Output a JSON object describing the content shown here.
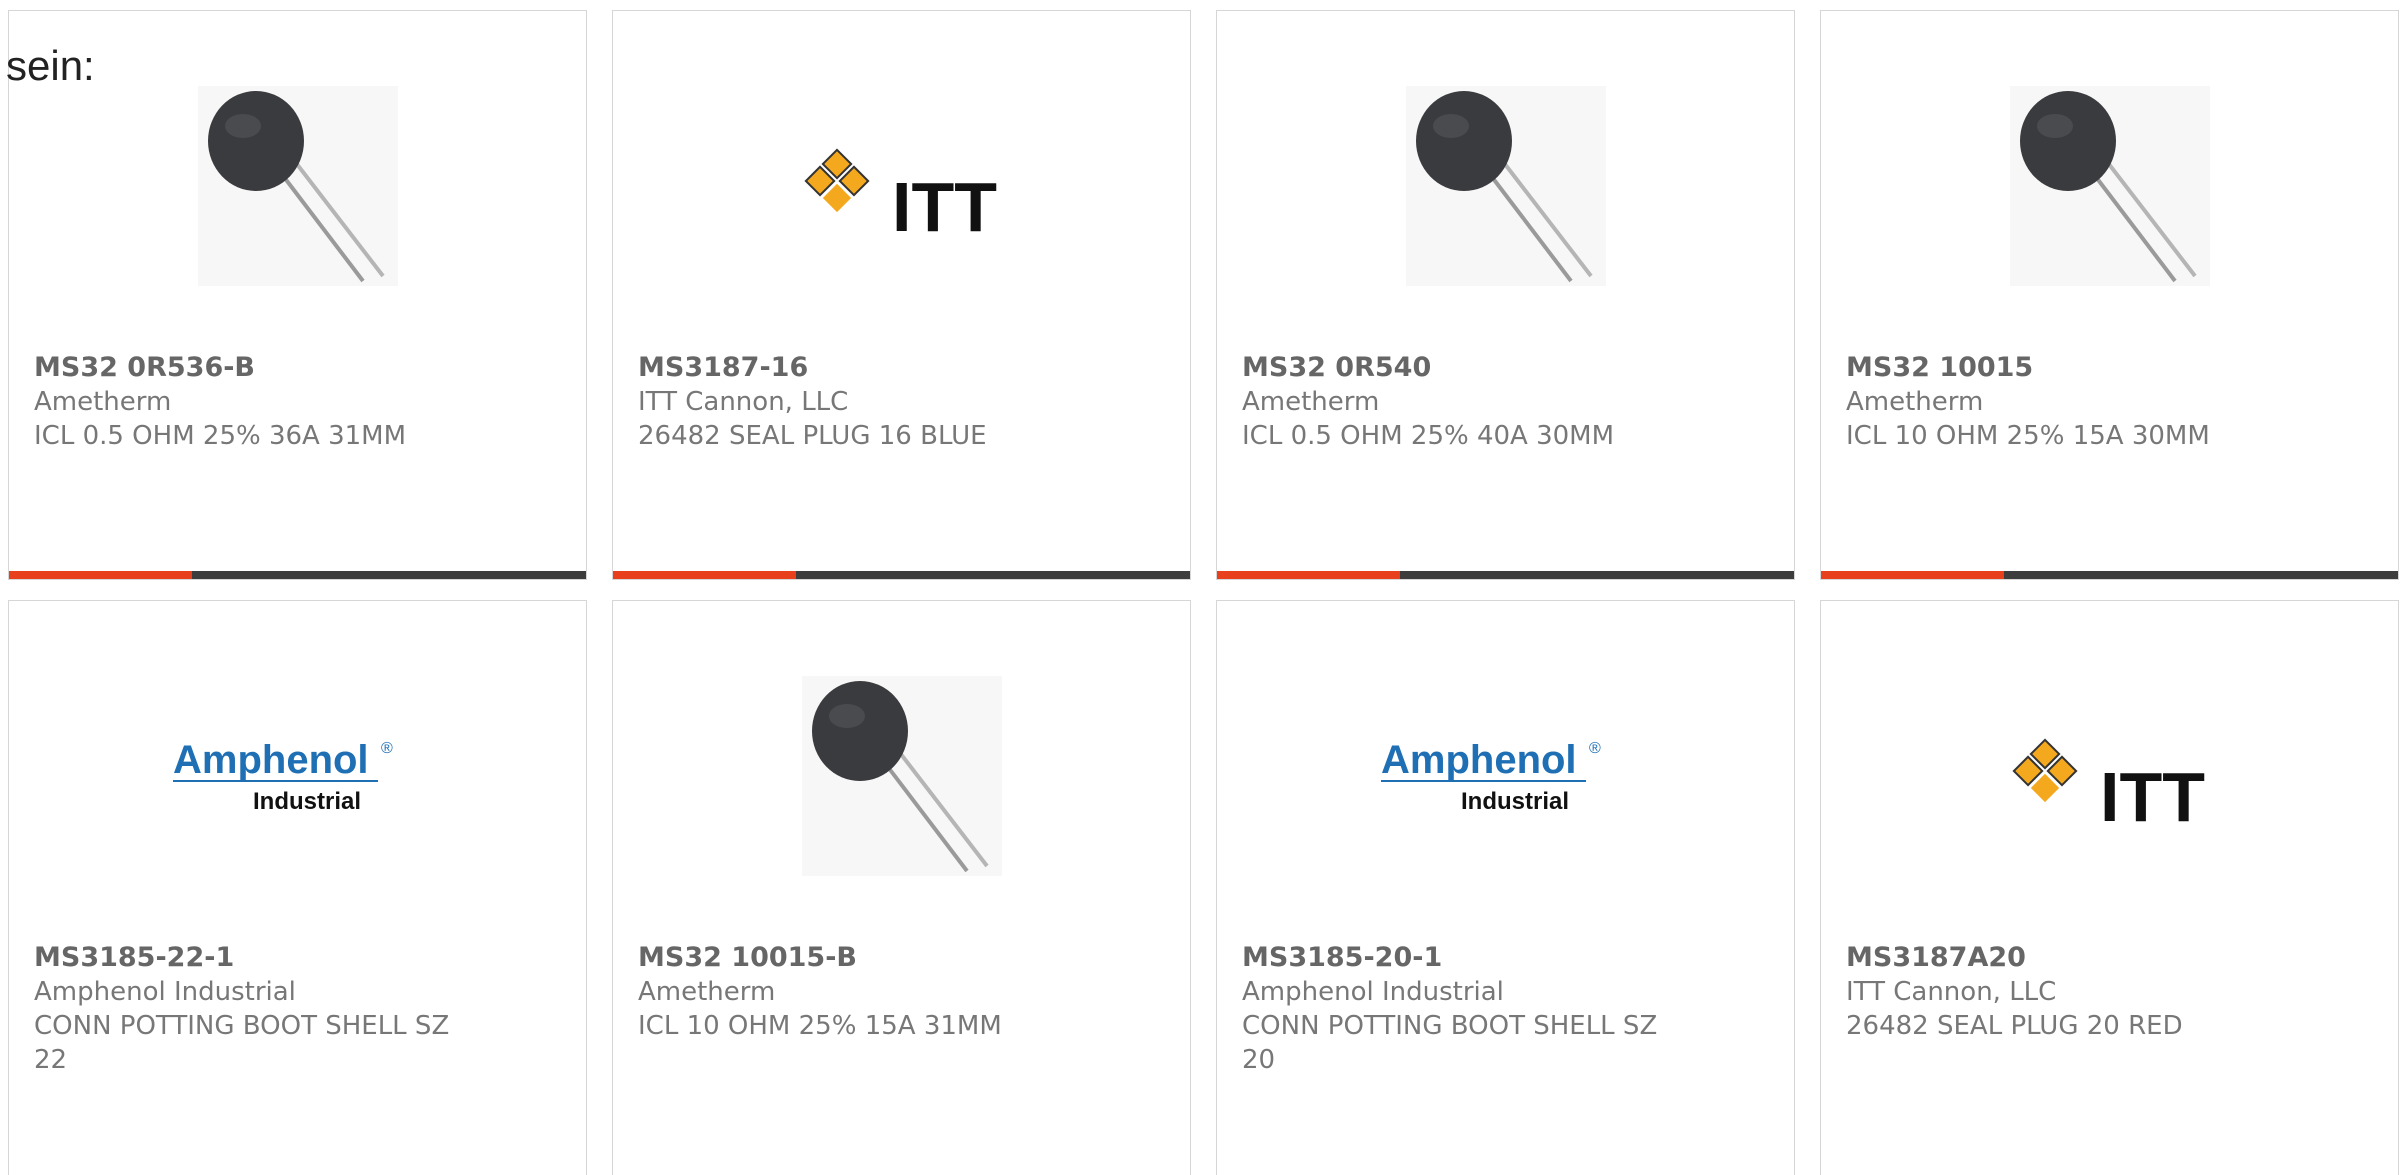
{
  "page": {
    "intro": "sein:"
  },
  "colors": {
    "accent": "#e8401c",
    "bar": "#3d3d3d",
    "border": "#d6d6d6",
    "text": "#777777",
    "amphenol_blue": "#1f6fb5",
    "itt_orange": "#f4a81d"
  },
  "products": [
    {
      "part_number": "MS32 0R536-B",
      "manufacturer": "Ametherm",
      "description": "ICL 0.5 OHM 25% 36A 31MM",
      "image": "thermistor-image",
      "has_bar": true
    },
    {
      "part_number": "MS3187-16",
      "manufacturer": "ITT Cannon, LLC",
      "description": "26482 SEAL PLUG 16 BLUE",
      "image": "itt-logo",
      "has_bar": true
    },
    {
      "part_number": "MS32 0R540",
      "manufacturer": "Ametherm",
      "description": "ICL 0.5 OHM 25% 40A 30MM",
      "image": "thermistor-image",
      "has_bar": true
    },
    {
      "part_number": "MS32 10015",
      "manufacturer": "Ametherm",
      "description": "ICL 10 OHM 25% 15A 30MM",
      "image": "thermistor-image",
      "has_bar": true
    },
    {
      "part_number": "MS3185-22-1",
      "manufacturer": "Amphenol Industrial",
      "description": "CONN POTTING BOOT SHELL SZ 22",
      "image": "amphenol-logo",
      "has_bar": false
    },
    {
      "part_number": "MS32 10015-B",
      "manufacturer": "Ametherm",
      "description": "ICL 10 OHM 25% 15A 31MM",
      "image": "thermistor-image",
      "has_bar": false
    },
    {
      "part_number": "MS3185-20-1",
      "manufacturer": "Amphenol Industrial",
      "description": "CONN POTTING BOOT SHELL SZ 20",
      "image": "amphenol-logo",
      "has_bar": false
    },
    {
      "part_number": "MS3187A20",
      "manufacturer": "ITT Cannon, LLC",
      "description": "26482 SEAL PLUG 20 RED",
      "image": "itt-logo",
      "has_bar": false
    }
  ],
  "logos": {
    "itt_text": "ITT",
    "amphenol_name": "Amphenol",
    "amphenol_mark": "®",
    "amphenol_sub": "Industrial"
  }
}
